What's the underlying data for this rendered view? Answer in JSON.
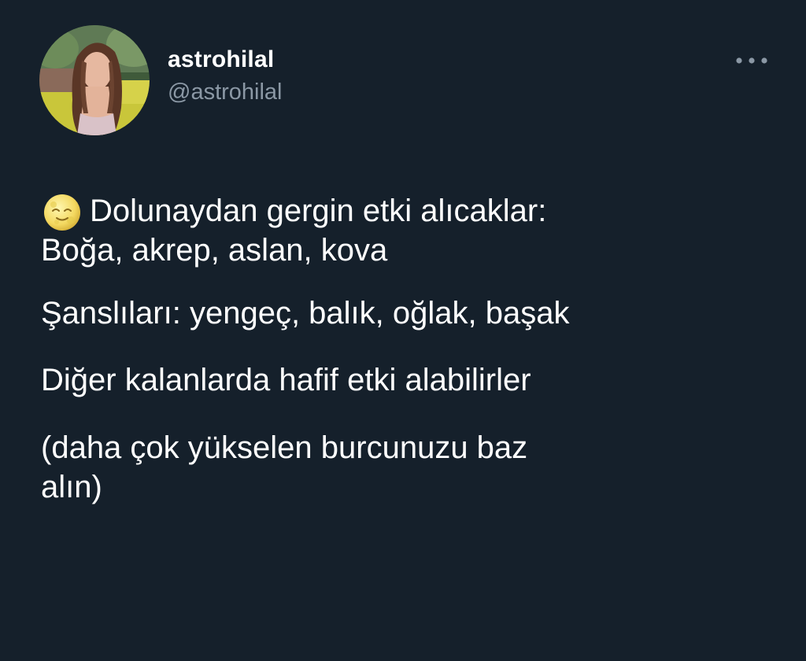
{
  "user": {
    "display_name": "astrohilal",
    "handle": "@astrohilal",
    "avatar_icon": "profile-photo-icon"
  },
  "actions": {
    "more_icon": "more-horizontal-icon"
  },
  "tweet": {
    "emoji_icon": "full-moon-face-icon",
    "line1": "Dolunaydan gergin etki alıcaklar:",
    "line2": "Boğa, akrep, aslan, kova",
    "line3": "Şanslıları: yengeç, balık, oğlak, başak",
    "line4": "Diğer kalanlarda hafif etki alabilirler",
    "line5": "(daha çok yükselen burcunuzu baz",
    "line6": "alın)"
  },
  "colors": {
    "background": "#15202b",
    "text_primary": "#ffffff",
    "text_secondary": "#8b98a5"
  }
}
